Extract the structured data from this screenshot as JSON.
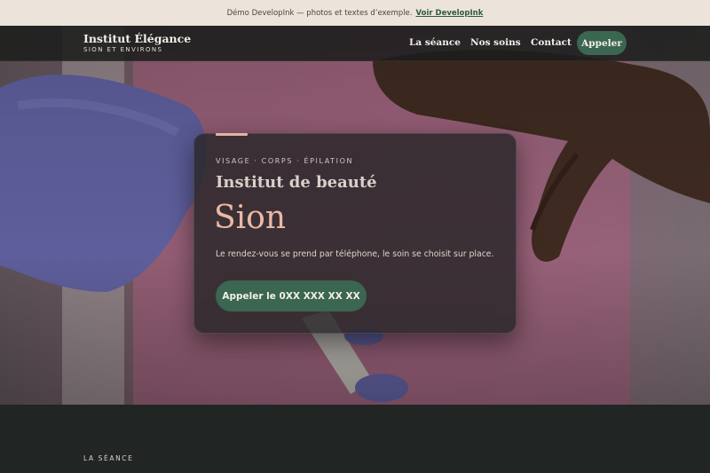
{
  "banner": {
    "text": "Démo DevelopInk — photos et textes d’exemple.",
    "link": "Voir DevelopInk"
  },
  "brand": {
    "title": "Institut Élégance",
    "subtitle": "SION ET ENVIRONS"
  },
  "nav": {
    "items": [
      "La séance",
      "Nos soins",
      "Contact"
    ],
    "cta": "Appeler"
  },
  "hero": {
    "eyebrow": "VISAGE · CORPS · ÉPILATION",
    "title": "Institut de beauté",
    "city": "Sion",
    "description": "Le rendez-vous se prend par téléphone, le soin se choisit sur place.",
    "button": "Appeler le 0XX XXX XX XX"
  },
  "section": {
    "label": "LA SÉANCE"
  },
  "colors": {
    "accent": "#3b6651",
    "highlight": "#ebb9a4",
    "banner_bg": "#ece4da",
    "dark": "#1f2221"
  }
}
